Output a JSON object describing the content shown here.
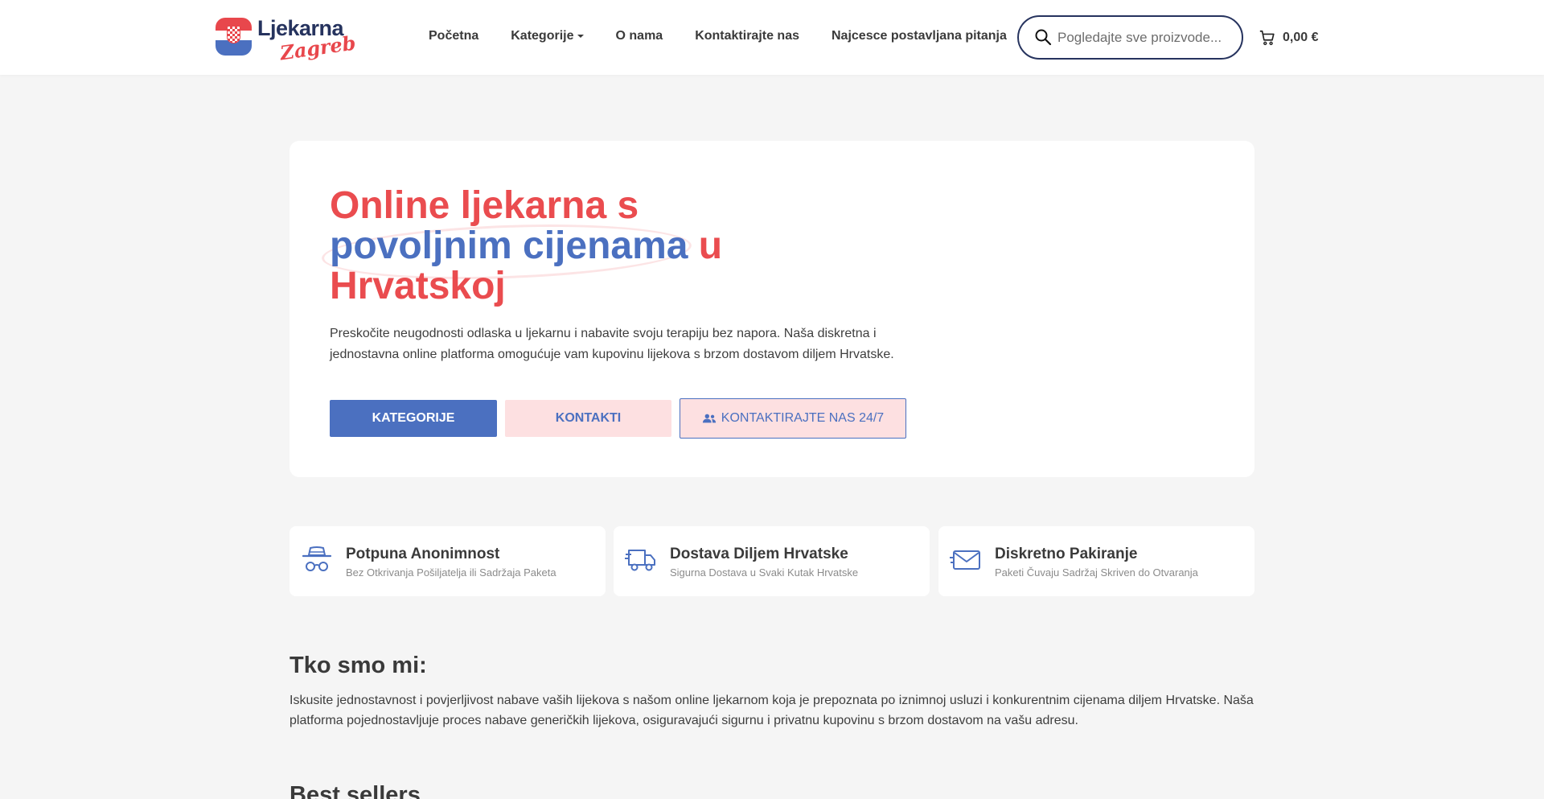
{
  "header": {
    "logo_line1": "Ljekarna",
    "logo_line2": "Zagreb",
    "nav": [
      {
        "label": "Početna"
      },
      {
        "label": "Kategorije"
      },
      {
        "label": "O nama"
      },
      {
        "label": "Kontaktirajte nas"
      },
      {
        "label": "Najcesce postavljana pitanja"
      }
    ],
    "search_placeholder": "Pogledajte sve proizvode...",
    "cart_amount": "0,00 €"
  },
  "hero": {
    "title_part1": "Online ljekarna s",
    "title_highlight": "povoljnim cijenama",
    "title_part2": "u",
    "title_part3": "Hrvatskoj",
    "description": "Preskočite neugodnosti odlaska u ljekarnu i nabavite svoju terapiju bez napora. Naša diskretna i jednostavna online platforma omogućuje vam kupovinu lijekova s brzom dostavom diljem Hrvatske.",
    "buttons": {
      "categories": "KATEGORIJE",
      "contacts": "KONTAKTI",
      "contact_247": "KONTAKTIRAJTE NAS 24/7"
    }
  },
  "features": [
    {
      "title": "Potpuna Anonimnost",
      "subtitle": "Bez Otkrivanja Pošiljatelja ili Sadržaja Paketa",
      "icon": "incognito-icon"
    },
    {
      "title": "Dostava Diljem Hrvatske",
      "subtitle": "Sigurna Dostava u Svaki Kutak Hrvatske",
      "icon": "delivery-truck-icon"
    },
    {
      "title": "Diskretno Pakiranje",
      "subtitle": "Paketi Čuvaju Sadržaj Skriven do Otvaranja",
      "icon": "envelope-icon"
    }
  ],
  "about": {
    "title": "Tko smo mi:",
    "text": "Iskusite jednostavnost i povjerljivost nabave vaših lijekova s našom online ljekarnom koja je prepoznata po iznimnoj usluzi i konkurentnim cijenama diljem Hrvatske. Naša platforma pojednostavljuje proces nabave generičkih lijekova, osiguravajući sigurnu i privatnu kupovinu s brzom dostavom na vašu adresu."
  },
  "best_sellers": {
    "title": "Best sellers"
  },
  "colors": {
    "brand_red": "#ea4c4f",
    "brand_blue": "#4b70c0",
    "brand_navy": "#26335e",
    "soft_pink": "#fde0e1"
  }
}
